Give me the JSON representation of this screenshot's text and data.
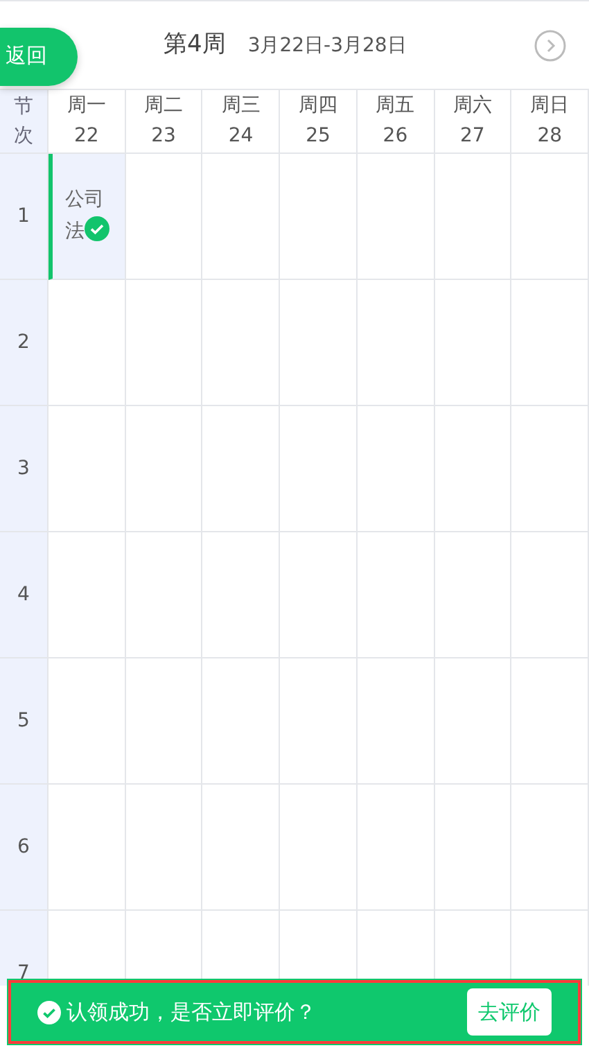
{
  "header": {
    "back_button": "返回",
    "week": "第4周",
    "date_range": "3月22日-3月28日"
  },
  "corner_label": "节次",
  "days": [
    {
      "weekday": "周一",
      "date": "22"
    },
    {
      "weekday": "周二",
      "date": "23"
    },
    {
      "weekday": "周三",
      "date": "24"
    },
    {
      "weekday": "周四",
      "date": "25"
    },
    {
      "weekday": "周五",
      "date": "26"
    },
    {
      "weekday": "周六",
      "date": "27"
    },
    {
      "weekday": "周日",
      "date": "28"
    }
  ],
  "periods": [
    {
      "number": "1",
      "courses": [
        {
          "name": "公司法",
          "claimed": true
        }
      ]
    },
    {
      "number": "2"
    },
    {
      "number": "3"
    },
    {
      "number": "4"
    },
    {
      "number": "5"
    },
    {
      "number": "6"
    },
    {
      "number": "7"
    }
  ],
  "banner": {
    "message": "认领成功，是否立即评价？",
    "button": "去评价",
    "highlighted": true
  }
}
